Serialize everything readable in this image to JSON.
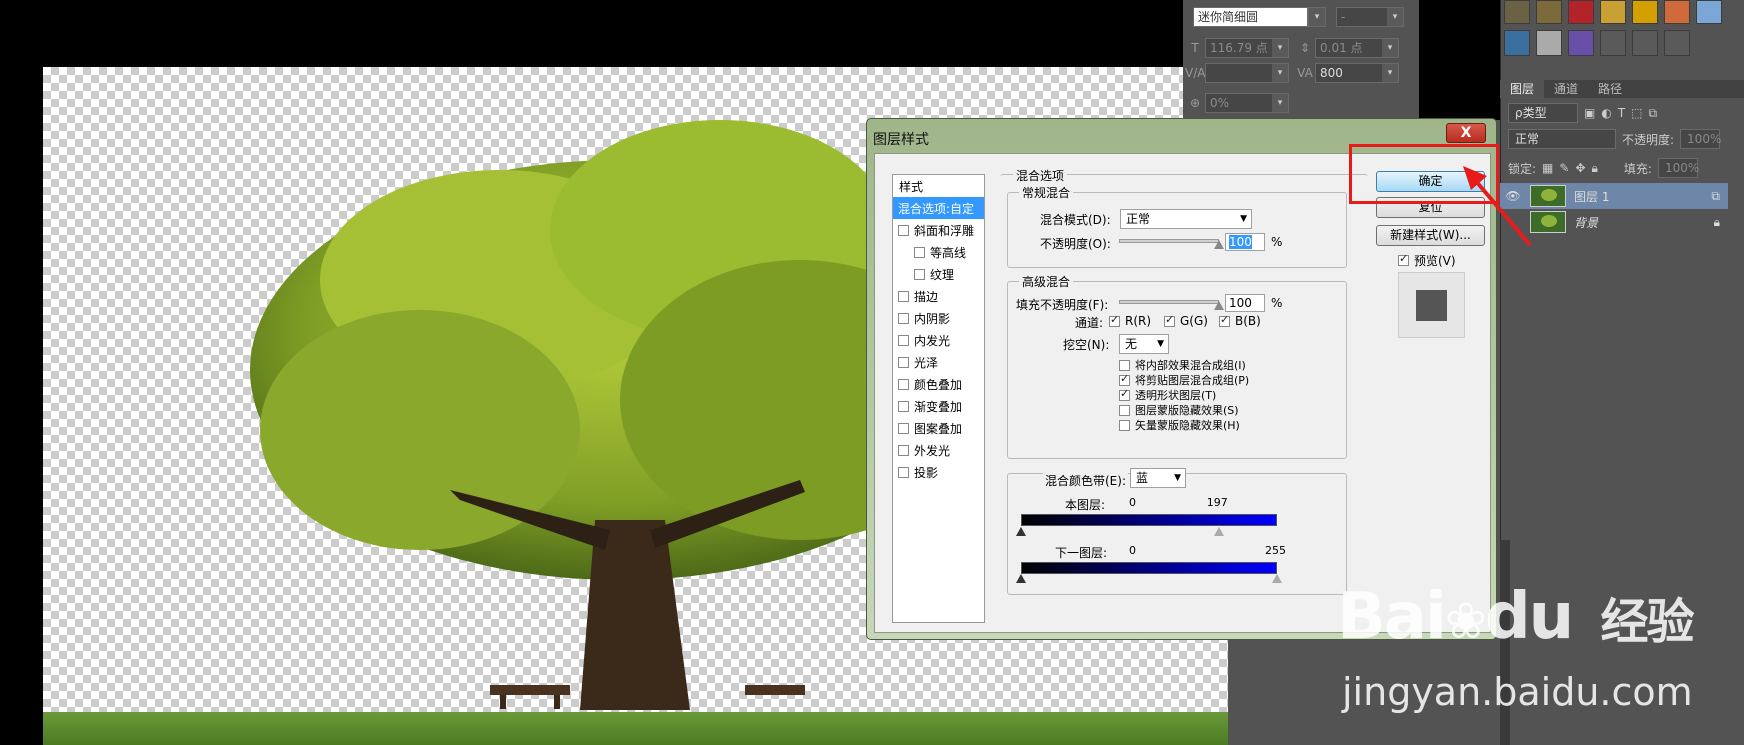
{
  "char_panel": {
    "font_name": "迷你简细圆",
    "font_style": "-",
    "size": "116.79 点",
    "leading": "0.01 点",
    "kerning": "",
    "tracking": "800",
    "baseline": "0%"
  },
  "layers_panel": {
    "tabs": [
      "图层",
      "通道",
      "路径"
    ],
    "filter_label": "ρ类型",
    "blend_mode": "正常",
    "opacity_label": "不透明度:",
    "opacity_value": "100%",
    "lock_label": "锁定:",
    "fill_label": "填充:",
    "fill_value": "100%",
    "layers": [
      {
        "name": "图层 1",
        "selected": true
      },
      {
        "name": "背景",
        "selected": false
      }
    ]
  },
  "dialog": {
    "title": "图层样式",
    "close_label": "X",
    "styles_header": "样式",
    "styles": [
      {
        "label": "混合选项:自定",
        "selected": true,
        "checkbox": false,
        "sub": false
      },
      {
        "label": "斜面和浮雕",
        "selected": false,
        "checkbox": true,
        "sub": false
      },
      {
        "label": "等高线",
        "selected": false,
        "checkbox": true,
        "sub": true
      },
      {
        "label": "纹理",
        "selected": false,
        "checkbox": true,
        "sub": true
      },
      {
        "label": "描边",
        "selected": false,
        "checkbox": true,
        "sub": false
      },
      {
        "label": "内阴影",
        "selected": false,
        "checkbox": true,
        "sub": false
      },
      {
        "label": "内发光",
        "selected": false,
        "checkbox": true,
        "sub": false
      },
      {
        "label": "光泽",
        "selected": false,
        "checkbox": true,
        "sub": false
      },
      {
        "label": "颜色叠加",
        "selected": false,
        "checkbox": true,
        "sub": false
      },
      {
        "label": "渐变叠加",
        "selected": false,
        "checkbox": true,
        "sub": false
      },
      {
        "label": "图案叠加",
        "selected": false,
        "checkbox": true,
        "sub": false
      },
      {
        "label": "外发光",
        "selected": false,
        "checkbox": true,
        "sub": false
      },
      {
        "label": "投影",
        "selected": false,
        "checkbox": true,
        "sub": false
      }
    ],
    "blend_options_title": "混合选项",
    "general_blending": "常规混合",
    "blend_mode_label": "混合模式(D):",
    "blend_mode_value": "正常",
    "opacity_label": "不透明度(O):",
    "opacity_value": "100",
    "percent": "%",
    "advanced_blending": "高级混合",
    "fill_opacity_label": "填充不透明度(F):",
    "fill_opacity_value": "100",
    "fill_opacity_fraction": 1.0,
    "opacity_fraction": 1.0,
    "channels_label": "通道:",
    "channel_r": "R(R)",
    "channel_g": "G(G)",
    "channel_b": "B(B)",
    "knockout_label": "挖空(N):",
    "knockout_value": "无",
    "options": [
      {
        "label": "将内部效果混合成组(I)",
        "checked": false
      },
      {
        "label": "将剪贴图层混合成组(P)",
        "checked": true
      },
      {
        "label": "透明形状图层(T)",
        "checked": true
      },
      {
        "label": "图层蒙版隐藏效果(S)",
        "checked": false
      },
      {
        "label": "矢量蒙版隐藏效果(H)",
        "checked": false
      }
    ],
    "blend_if_label": "混合颜色带(E):",
    "blend_if_value": "蓝",
    "this_layer_label": "本图层:",
    "this_layer_low": "0",
    "this_layer_high": "197",
    "this_layer_high_value": 197,
    "underlying_label": "下一图层:",
    "underlying_low": "0",
    "underlying_high": "255",
    "underlying_high_value": 255,
    "ok_label": "确定",
    "reset_label": "复位",
    "new_style_label": "新建样式(W)...",
    "preview_label": "预览(V)",
    "preview_checked": true
  },
  "watermark": {
    "brand": "Bai",
    "brand2": "du",
    "suffix": "经验",
    "url": "jingyan.baidu.com"
  },
  "colors": {
    "accent": "#3399ff",
    "highlight": "#e81b1b",
    "panel": "#535353"
  }
}
